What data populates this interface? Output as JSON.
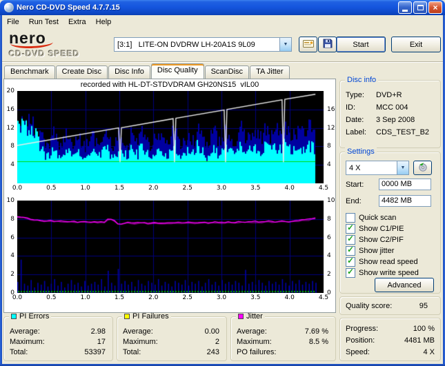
{
  "window": {
    "title": "Nero CD-DVD Speed 4.7.7.15",
    "close_glyph": "×"
  },
  "glyphs": {
    "dropdown": "▼"
  },
  "menu": {
    "items": [
      {
        "label": "File"
      },
      {
        "label": "Run Test"
      },
      {
        "label": "Extra"
      },
      {
        "label": "Help"
      }
    ]
  },
  "toolbar": {
    "logo_line1": "nero",
    "logo_line2": "CD-DVD SPEED",
    "drive": "[3:1]   LITE-ON DVDRW LH-20A1S 9L09",
    "start_label": "Start",
    "exit_label": "Exit"
  },
  "tabs": {
    "items": [
      {
        "label": "Benchmark"
      },
      {
        "label": "Create Disc"
      },
      {
        "label": "Disc Info"
      },
      {
        "label": "Disc Quality"
      },
      {
        "label": "ScanDisc"
      },
      {
        "label": "TA Jitter"
      }
    ],
    "active": "Disc Quality"
  },
  "graph": {
    "header": "recorded with HL-DT-STDVDRAM GH20NS15  vIL00"
  },
  "disc_info": {
    "title": "Disc info",
    "rows": [
      {
        "label": "Type:",
        "value": "DVD+R"
      },
      {
        "label": "ID:",
        "value": "MCC 004"
      },
      {
        "label": "Date:",
        "value": "3 Sep 2008"
      },
      {
        "label": "Label:",
        "value": "CDS_TEST_B2"
      }
    ]
  },
  "settings": {
    "title": "Settings",
    "speed_value": "4 X",
    "start_label": "Start:",
    "start_value": "0000 MB",
    "end_label": "End:",
    "end_value": "4482 MB",
    "checkboxes": [
      {
        "label": "Quick scan",
        "mark": ""
      },
      {
        "label": "Show C1/PIE",
        "mark": "✓"
      },
      {
        "label": "Show C2/PIF",
        "mark": "✓"
      },
      {
        "label": "Show jitter",
        "mark": "✓"
      },
      {
        "label": "Show read speed",
        "mark": "✓"
      },
      {
        "label": "Show write speed",
        "mark": "✓"
      }
    ],
    "advanced_label": "Advanced"
  },
  "quality": {
    "label": "Quality score:",
    "value": "95"
  },
  "status": {
    "rows": [
      {
        "label": "Progress:",
        "value": "100 %"
      },
      {
        "label": "Position:",
        "value": "4481 MB"
      },
      {
        "label": "Speed:",
        "value": "4 X"
      }
    ]
  },
  "panels": [
    {
      "title": "PI Errors",
      "color": "#00FFFF",
      "rows": [
        {
          "label": "Average:",
          "value": "2.98"
        },
        {
          "label": "Maximum:",
          "value": "17"
        },
        {
          "label": "Total:",
          "value": "53397"
        }
      ]
    },
    {
      "title": "PI Failures",
      "color": "#FFFF00",
      "rows": [
        {
          "label": "Average:",
          "value": "0.00"
        },
        {
          "label": "Maximum:",
          "value": "2"
        },
        {
          "label": "Total:",
          "value": "243"
        }
      ]
    },
    {
      "title": "Jitter",
      "color": "#FF00FF",
      "rows": [
        {
          "label": "Average:",
          "value": "7.69 %"
        },
        {
          "label": "Maximum:",
          "value": "8.5 %"
        },
        {
          "label": "PO failures:",
          "value": ""
        }
      ]
    }
  ],
  "chart_data": [
    {
      "type": "area",
      "title": "PI Errors (C1/PIE) with read/write speed overlay",
      "xlim": [
        0,
        4.5
      ],
      "ylim": [
        0,
        20
      ],
      "x_max": 4.38,
      "x_ticks": [
        "0.0",
        "0.5",
        "1.0",
        "1.5",
        "2.0",
        "2.5",
        "3.0",
        "3.5",
        "4.0",
        "4.5"
      ],
      "y_ticks_left": [
        20,
        16,
        12,
        8,
        4
      ],
      "y_ticks_right": [
        16,
        12,
        8,
        4
      ],
      "grid_y": [
        4,
        8,
        12,
        16
      ],
      "colors": {
        "bg": "#000000",
        "grid": "#00007D",
        "surface": "#00FFFF",
        "peaks": "#0000A0"
      },
      "read_line": {
        "y": 4.8,
        "color": "#00D800"
      },
      "write_line": {
        "color": "#EBEBEB",
        "points": [
          [
            0,
            8.2
          ],
          [
            1.49,
            12.0
          ],
          [
            1.51,
            4.6
          ],
          [
            1.53,
            12.05
          ],
          [
            2.29,
            14.0
          ],
          [
            2.31,
            4.6
          ],
          [
            2.33,
            14.1
          ],
          [
            3.04,
            15.9
          ],
          [
            3.06,
            4.6
          ],
          [
            3.08,
            16.0
          ],
          [
            3.89,
            18.1
          ],
          [
            3.91,
            4.6
          ],
          [
            3.93,
            18.2
          ],
          [
            4.38,
            19.3
          ]
        ]
      },
      "pie_surface": [
        11.8,
        12.4,
        11.6,
        12.8,
        12.1,
        10.9,
        9.6,
        7.4,
        6.5,
        5.9,
        6.8,
        7.9,
        6.3,
        5.7,
        7.0,
        7.5,
        6.2,
        5.9,
        8.3,
        6.7,
        5.5,
        6.3,
        7.2,
        6.9,
        5.8,
        6.4,
        8.9,
        7.3,
        6.1,
        5.6,
        6.8,
        8.0,
        6.4,
        5.9,
        7.5,
        6.7,
        6.2,
        9.3,
        7.1,
        6.3,
        5.7,
        6.5,
        7.8,
        7.0,
        5.9,
        6.6,
        7.3,
        8.5,
        6.8,
        6.0,
        6.4,
        7.6,
        6.9,
        6.1,
        9.0,
        7.4,
        6.5,
        5.8,
        7.1,
        7.9,
        6.6,
        6.2,
        7.7,
        8.2,
        7.0,
        6.3,
        7.4,
        8.7,
        7.2,
        6.6,
        7.9,
        8.4,
        7.5,
        6.9,
        8.1,
        7.6,
        7.1,
        8.6,
        7.8,
        7.3,
        8.9,
        8.2,
        7.6,
        7.0,
        8.3,
        7.7,
        7.2,
        8.8,
        8.0,
        7.5
      ],
      "pie_peaks": [
        13.6,
        14.3,
        13.1,
        14.9,
        13.9,
        12.6,
        11.1,
        10.4,
        9.7,
        8.8,
        10.1,
        11.9,
        9.3,
        8.1,
        10.7,
        11.3,
        9.1,
        8.7,
        12.5,
        10.0,
        8.2,
        9.5,
        10.9,
        10.3,
        8.5,
        9.7,
        13.3,
        11.1,
        9.2,
        8.3,
        10.3,
        12.1,
        9.8,
        8.8,
        11.3,
        10.1,
        9.3,
        14.1,
        10.7,
        9.5,
        8.5,
        9.9,
        11.7,
        10.5,
        8.9,
        9.9,
        11.0,
        12.9,
        10.3,
        9.0,
        9.6,
        11.5,
        10.4,
        9.2,
        13.5,
        11.2,
        9.8,
        8.7,
        10.7,
        11.9,
        10.0,
        9.3,
        11.6,
        12.4,
        10.5,
        9.5,
        11.1,
        13.1,
        10.9,
        9.9,
        11.9,
        12.7,
        11.3,
        10.3,
        12.2,
        11.5,
        10.7,
        12.9,
        11.8,
        11.0,
        13.4,
        12.5,
        11.6,
        10.8,
        12.8,
        12.1,
        11.2,
        13.2,
        12.3,
        11.4
      ]
    },
    {
      "type": "line+bars",
      "title": "Jitter (%) with PI Failures (C2/PIF) bars",
      "xlim": [
        0,
        4.5
      ],
      "ylim": [
        0,
        10
      ],
      "x_max": 4.38,
      "x_ticks": [
        "0.0",
        "0.5",
        "1.0",
        "1.5",
        "2.0",
        "2.5",
        "3.0",
        "3.5",
        "4.0",
        "4.5"
      ],
      "y_ticks_left": [
        10,
        8,
        6,
        4,
        2,
        0
      ],
      "y_ticks_right": [
        10,
        8,
        6,
        4,
        2,
        0
      ],
      "grid_y": [
        2,
        4,
        6,
        8
      ],
      "colors": {
        "bg": "#000000",
        "grid": "#00007D",
        "pif": "#0000A8",
        "marks": "#00B400",
        "jitter": "#FF00FF"
      },
      "jitter": [
        8.3,
        8.24,
        8.18,
        8.1,
        8.02,
        7.96,
        7.92,
        7.88,
        7.84,
        7.86,
        7.82,
        7.78,
        7.8,
        7.76,
        7.72,
        7.74,
        7.78,
        7.73,
        7.69,
        7.72,
        7.75,
        7.71,
        7.68,
        7.72,
        7.7,
        7.66,
        7.7,
        7.95,
        8.02,
        7.8,
        7.52,
        7.48,
        7.55,
        7.62,
        7.58,
        7.55,
        7.6,
        7.63,
        7.59,
        7.56,
        7.6,
        7.62,
        7.58,
        7.55,
        7.6,
        7.64,
        7.61,
        7.58,
        7.62,
        7.6,
        7.63,
        7.66,
        7.62,
        7.59,
        7.63,
        7.67,
        7.64,
        7.6,
        7.65,
        7.68,
        7.65,
        7.62,
        7.66,
        7.7,
        7.67,
        7.64,
        7.68,
        7.72,
        7.69,
        7.66,
        7.7,
        7.74,
        7.71,
        7.68,
        7.73,
        7.76,
        7.73,
        7.7,
        7.75,
        7.78,
        7.75,
        7.72,
        7.77,
        7.8,
        7.84,
        7.88,
        7.92,
        7.97,
        8.03,
        8.1
      ],
      "pif_bars": [
        1.2,
        3.6,
        1.0,
        0.8,
        1.4,
        0.6,
        1.1,
        0.9,
        1.3,
        0.7,
        1.0,
        1.5,
        0.8,
        1.2,
        0.6,
        1.0,
        1.4,
        0.9,
        1.1,
        0.7,
        1.3,
        0.8,
        1.0,
        1.2,
        0.9,
        1.5,
        0.7,
        2.4,
        1.1,
        0.8,
        2.6,
        1.0,
        1.3,
        0.9,
        1.2,
        0.7,
        1.4,
        1.0,
        0.8,
        1.3,
        1.1,
        0.9,
        1.5,
        0.8,
        1.2,
        1.0,
        0.7,
        1.3,
        1.1,
        0.9,
        1.4,
        0.8,
        1.2,
        1.0,
        1.3,
        0.7,
        1.1,
        1.5,
        0.9,
        1.2,
        0.8,
        1.4,
        1.0,
        1.2,
        0.9,
        1.3,
        1.1,
        0.8,
        2.5,
        1.0,
        1.2,
        0.9,
        1.4,
        1.1,
        0.8,
        1.3,
        1.0,
        1.2,
        0.9,
        1.5,
        1.1,
        0.8,
        1.3,
        1.0,
        1.4,
        0.9,
        1.2,
        1.0,
        1.3,
        1.1
      ]
    }
  ]
}
